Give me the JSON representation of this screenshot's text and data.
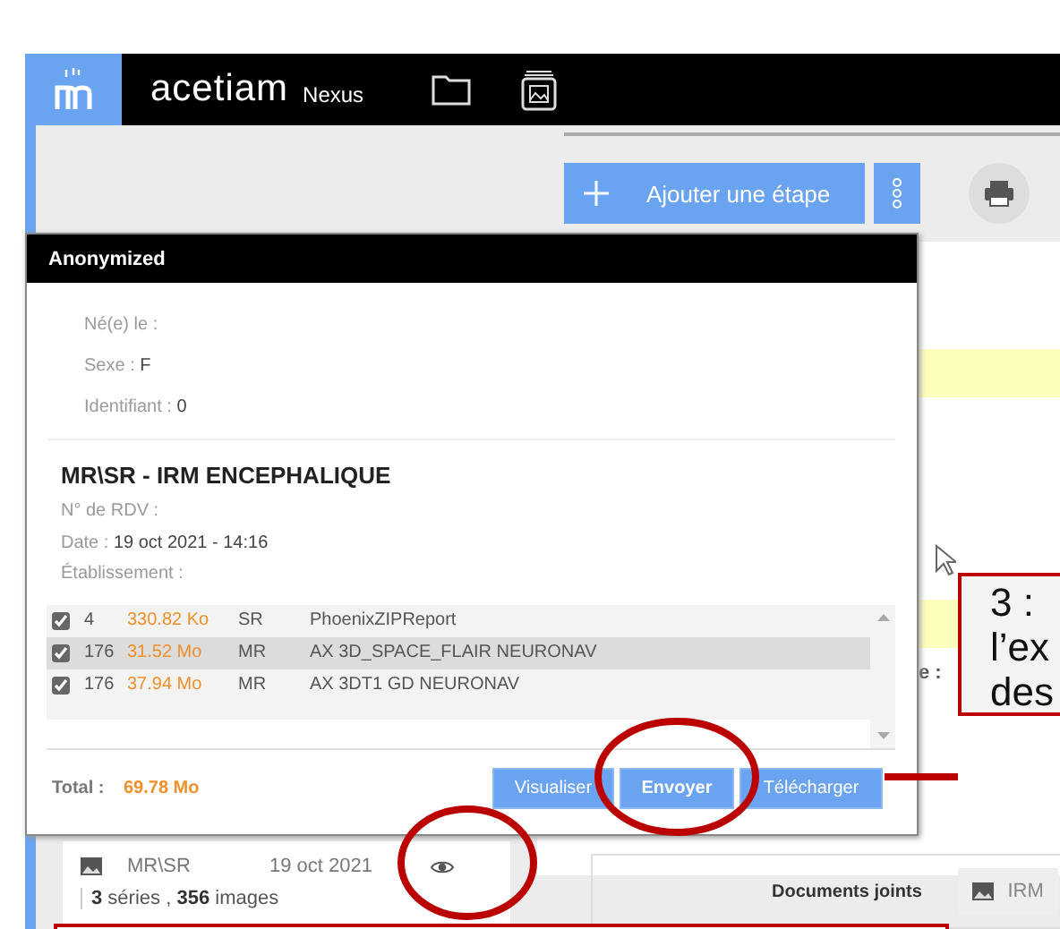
{
  "header": {
    "logo": "acetiam",
    "product": "Nexus"
  },
  "toolbar": {
    "add_step": "Ajouter une étape"
  },
  "side_panel": {
    "partial_label": "e :"
  },
  "study_card": {
    "modality": "MR\\SR",
    "date": "19 oct 2021",
    "summary": "**3** séries , **356** images"
  },
  "documents": {
    "label": "Documents joints",
    "attachment": "IRM"
  },
  "dialog": {
    "title": "Anonymized",
    "patient_fields": [
      {
        "label": "Né(e) le :"
      },
      {
        "label": "Sexe :",
        "value": "F"
      },
      {
        "label": "Identifiant :",
        "value": "0"
      }
    ],
    "exam_title": "MR\\SR - IRM ENCEPHALIQUE",
    "exam_fields": [
      {
        "label": "N° de RDV :"
      },
      {
        "label": "Date :",
        "value": "19 oct 2021 - 14:16"
      },
      {
        "label": "Établissement :"
      }
    ],
    "series": [
      {
        "checked": true,
        "selected": false,
        "count": "4",
        "size": "330.82 Ko",
        "modality": "SR",
        "description": "PhoenixZIPReport"
      },
      {
        "checked": true,
        "selected": true,
        "count": "176",
        "size": "31.52 Mo",
        "modality": "MR",
        "description": "AX 3D_SPACE_FLAIR NEURONAV"
      },
      {
        "checked": true,
        "selected": false,
        "count": "176",
        "size": "37.94 Mo",
        "modality": "MR",
        "description": "AX 3DT1 GD NEURONAV"
      }
    ],
    "total_label": "Total :",
    "total": "69.78 Mo",
    "buttons": [
      "Visualiser",
      "Envoyer",
      "Télécharger"
    ]
  },
  "annotation": {
    "callout_lines": [
      "3 :",
      "l’ex",
      "des"
    ]
  }
}
